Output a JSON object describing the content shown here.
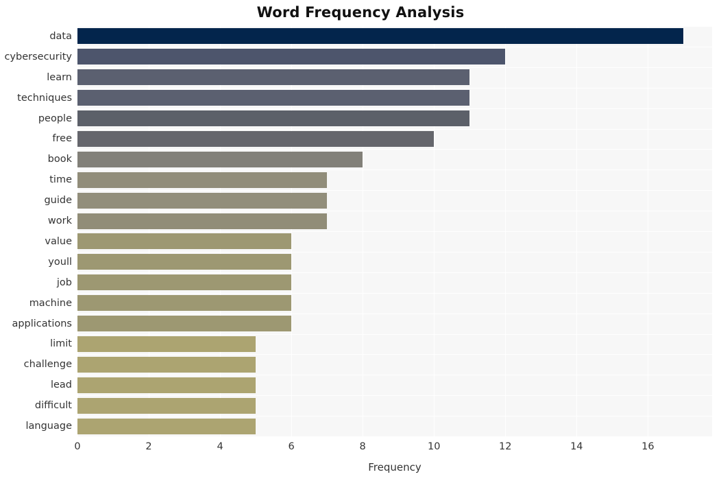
{
  "chart_data": {
    "type": "bar",
    "orientation": "horizontal",
    "title": "Word Frequency Analysis",
    "xlabel": "Frequency",
    "ylabel": "",
    "xlim": [
      0,
      17.8
    ],
    "xticks": [
      0,
      2,
      4,
      6,
      8,
      10,
      12,
      14,
      16
    ],
    "grid": true,
    "legend": "none",
    "categories": [
      "data",
      "cybersecurity",
      "learn",
      "techniques",
      "people",
      "free",
      "book",
      "time",
      "guide",
      "work",
      "value",
      "youll",
      "job",
      "machine",
      "applications",
      "limit",
      "challenge",
      "lead",
      "difficult",
      "language"
    ],
    "values": [
      17,
      12,
      11,
      11,
      11,
      10,
      8,
      7,
      7,
      7,
      6,
      6,
      6,
      6,
      6,
      5,
      5,
      5,
      5,
      5
    ],
    "bar_colors": [
      "#03254c",
      "#4d556c",
      "#5b6070",
      "#5b6070",
      "#5c6069",
      "#65666c",
      "#828079",
      "#918d7a",
      "#928e7b",
      "#918d78",
      "#9d9872",
      "#9d9872",
      "#9d9872",
      "#9d9872",
      "#9d9872",
      "#ac a471",
      "#aca471",
      "#aca471",
      "#aca471",
      "#aca471"
    ],
    "plot_background": "#f7f7f7",
    "gridline_color": "#ffffff",
    "figure_background": "#ffffff"
  }
}
